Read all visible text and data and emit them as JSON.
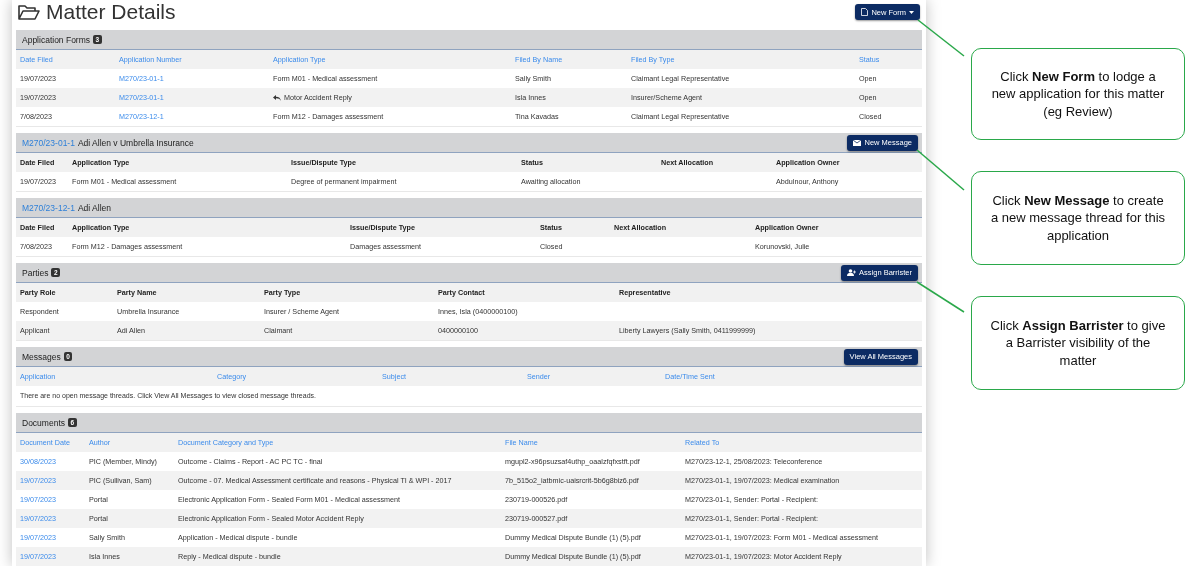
{
  "page": {
    "title": "Matter Details",
    "new_form_button": "New Form"
  },
  "sections": [
    {
      "kind": "list",
      "title": "Application Forms",
      "count": "3",
      "sortable_headers": true,
      "columns": [
        {
          "label": "Date Filed",
          "link": false
        },
        {
          "label": "Application Number",
          "link": true
        },
        {
          "label": "Application Type",
          "link": false
        },
        {
          "label": "Filed By Name",
          "link": false
        },
        {
          "label": "Filed By Type",
          "link": false
        },
        {
          "label": "Status",
          "link": false
        }
      ],
      "rows": [
        [
          "19/07/2023",
          "M270/23-01-1",
          "Form M01 - Medical assessment",
          "Sally Smith",
          "Claimant Legal Representative",
          "Open"
        ],
        [
          "19/07/2023",
          "M270/23-01-1",
          {
            "text": "Motor Accident Reply",
            "kind": "reply"
          },
          "Isla Innes",
          "Insurer/Scheme Agent",
          "Open"
        ],
        [
          "7/08/2023",
          "M270/23-12-1",
          "Form M12 - Damages assessment",
          "Tina Kavadas",
          "Claimant Legal Representative",
          "Closed"
        ]
      ]
    },
    {
      "kind": "application",
      "link": "M270/23-01-1",
      "title": "Adi Allen v Umbrella Insurance",
      "button": {
        "label": "New Message",
        "kind": "message"
      },
      "sortable_headers": false,
      "columns": [
        {
          "label": "Date Filed",
          "link": false
        },
        {
          "label": "Application Type",
          "link": false
        },
        {
          "label": "Issue/Dispute Type",
          "link": false
        },
        {
          "label": "Status",
          "link": false
        },
        {
          "label": "Next Allocation",
          "link": false
        },
        {
          "label": "Application Owner",
          "link": false
        }
      ],
      "rows": [
        [
          "19/07/2023",
          "Form M01 - Medical assessment",
          "Degree of permanent impairment",
          "Awaiting allocation",
          "",
          "Abdulnour, Anthony"
        ]
      ]
    },
    {
      "kind": "application",
      "link": "M270/23-12-1",
      "title": "Adi Allen",
      "sortable_headers": false,
      "columns": [
        {
          "label": "Date Filed",
          "link": false
        },
        {
          "label": "Application Type",
          "link": false
        },
        {
          "label": "Issue/Dispute Type",
          "link": false
        },
        {
          "label": "Status",
          "link": false
        },
        {
          "label": "Next Allocation",
          "link": false
        },
        {
          "label": "Application Owner",
          "link": false
        }
      ],
      "rows": [
        [
          "7/08/2023",
          "Form M12 - Damages assessment",
          "Damages assessment",
          "Closed",
          "",
          "Korunovski, Julie"
        ]
      ]
    },
    {
      "kind": "list",
      "title": "Parties",
      "count": "2",
      "button": {
        "label": "Assign Barrister",
        "kind": "person"
      },
      "sortable_headers": false,
      "columns": [
        {
          "label": "Party Role",
          "link": false
        },
        {
          "label": "Party Name",
          "link": false
        },
        {
          "label": "Party Type",
          "link": false
        },
        {
          "label": "Party Contact",
          "link": false
        },
        {
          "label": "Representative",
          "link": false
        }
      ],
      "rows": [
        [
          "Respondent",
          "Umbrella Insurance",
          "Insurer / Scheme Agent",
          "Innes, Isla (0400000100)",
          ""
        ],
        [
          "Applicant",
          "Adi Allen",
          "Claimant",
          "0400000100",
          "Liberty Lawyers (Sally Smith, 0411999999)"
        ]
      ]
    },
    {
      "kind": "list",
      "title": "Messages",
      "count": "0",
      "button": {
        "label": "View All Messages",
        "kind": "plain"
      },
      "sortable_headers": true,
      "columns": [
        {
          "label": "Application"
        },
        {
          "label": "Category"
        },
        {
          "label": "Subject"
        },
        {
          "label": "Sender"
        },
        {
          "label": "Date/Time Sent"
        }
      ],
      "note": "There are no open message threads. Click View All Messages to view closed message threads."
    },
    {
      "kind": "list",
      "title": "Documents",
      "count": "6",
      "sortable_headers": true,
      "columns": [
        {
          "label": "Document Date",
          "link": true
        },
        {
          "label": "Author",
          "link": false
        },
        {
          "label": "Document Category and Type",
          "link": false
        },
        {
          "label": "File Name",
          "link": false
        },
        {
          "label": "Related To",
          "link": false
        }
      ],
      "rows": [
        [
          "30/08/2023",
          "PIC (Member, Mindy)",
          "Outcome - Claims - Report - AC PC TC - final",
          "mgupl2-x96psuzsaf4uthp_oaalzfqfxstft.pdf",
          "M270/23-12-1, 25/08/2023: Teleconference"
        ],
        [
          "19/07/2023",
          "PIC (Sullivan, Sam)",
          "Outcome - 07. Medical Assessment certificate and reasons - Physical TI & WPI - 2017",
          "7b_515o2_iatbmic-uaisrcrit-5b6g8biz6.pdf",
          "M270/23-01-1, 19/07/2023: Medical examination"
        ],
        [
          "19/07/2023",
          "Portal",
          "Electronic Application Form - Sealed Form M01 - Medical assessment",
          "230719-000526.pdf",
          "M270/23-01-1, Sender: Portal - Recipient:"
        ],
        [
          "19/07/2023",
          "Portal",
          "Electronic Application Form - Sealed Motor Accident Reply",
          "230719-000527.pdf",
          "M270/23-01-1, Sender: Portal - Recipient:"
        ],
        [
          "19/07/2023",
          "Sally Smith",
          "Application - Medical dispute - bundle",
          "Dummy Medical Dispute Bundle (1) (5).pdf",
          "M270/23-01-1, 19/07/2023: Form M01 - Medical assessment"
        ],
        [
          "19/07/2023",
          "Isla Innes",
          "Reply - Medical dispute - bundle",
          "Dummy Medical Dispute Bundle (1) (5).pdf",
          "M270/23-01-1, 19/07/2023: Motor Accident Reply"
        ]
      ]
    }
  ],
  "callouts": [
    "Click **New Form** to lodge a new application for this matter (eg Review)",
    "Click **New Message** to create a new message thread for this application",
    "Click **Assign Barrister** to give a Barrister visibility of the matter"
  ]
}
